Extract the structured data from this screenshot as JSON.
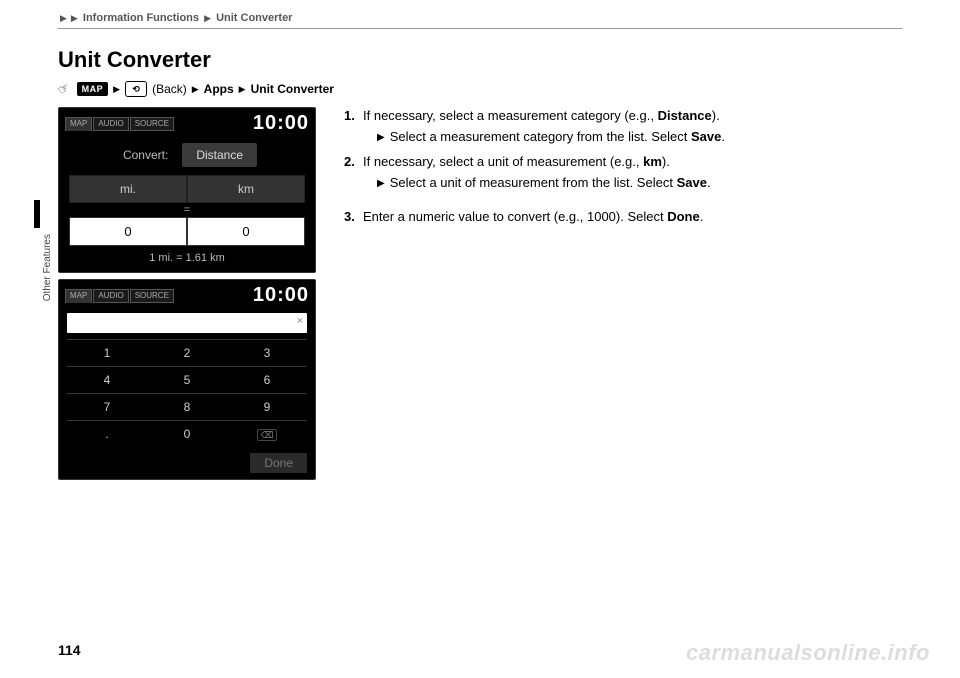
{
  "breadcrumb": {
    "a": "Information Functions",
    "b": "Unit Converter"
  },
  "title": "Unit Converter",
  "navpath": {
    "map": "MAP",
    "back_word": "(Back)",
    "apps": "Apps",
    "unitconv": "Unit Converter"
  },
  "screen1": {
    "tab_map": "MAP",
    "tab_audio": "AUDIO",
    "tab_source": "SOURCE",
    "clock": "10:00",
    "convert_label": "Convert:",
    "category": "Distance",
    "unit_left": "mi.",
    "unit_right": "km",
    "eq": "=",
    "val_left": "0",
    "val_right": "0",
    "formula": "1 mi. = 1.61 km"
  },
  "screen2": {
    "tab_map": "MAP",
    "tab_audio": "AUDIO",
    "tab_source": "SOURCE",
    "clock": "10:00",
    "keys": [
      "1",
      "2",
      "3",
      "4",
      "5",
      "6",
      "7",
      "8",
      "9",
      ".",
      "0",
      ""
    ],
    "done": "Done"
  },
  "steps": {
    "s1a": "If necessary, select a measurement category (e.g., ",
    "s1b": "Distance",
    "s1c": ").",
    "s1sub_a": "Select a measurement category from the list. Select ",
    "s1sub_b": "Save",
    "s1sub_c": ".",
    "s2a": "If necessary, select a unit of measurement (e.g., ",
    "s2b": "km",
    "s2c": ").",
    "s2sub_a": "Select a unit of measurement from the list. Select ",
    "s2sub_b": "Save",
    "s2sub_c": ".",
    "s3a": "Enter a numeric value to convert (e.g., 1000). Select ",
    "s3b": "Done",
    "s3c": "."
  },
  "side": "Other Features",
  "page_num": "114",
  "watermark": "carmanualsonline.info"
}
